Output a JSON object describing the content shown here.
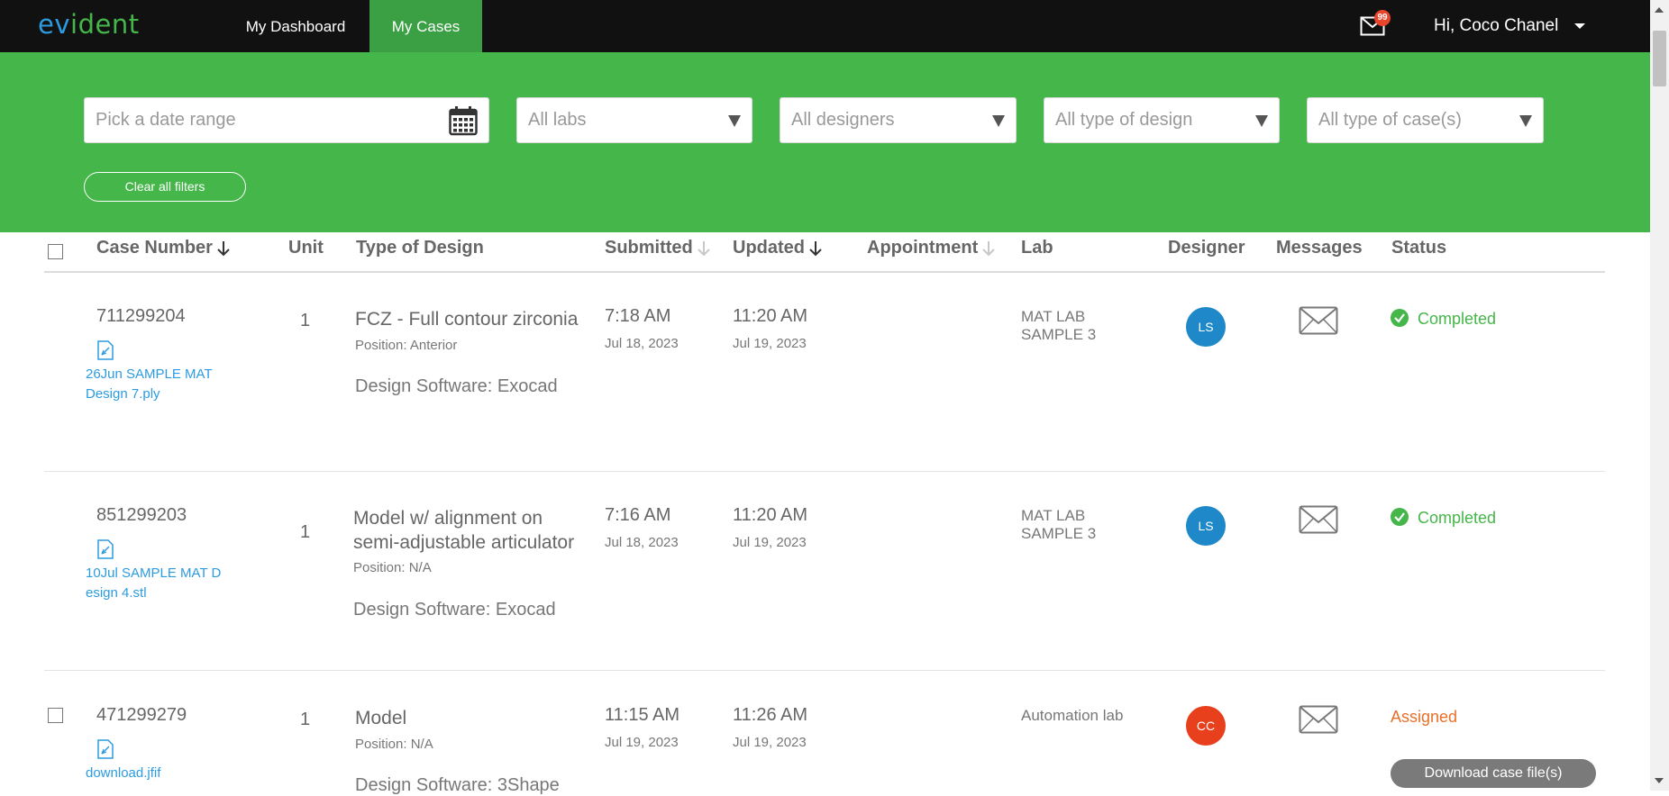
{
  "app": {
    "logo_part1": "ev",
    "logo_part2": "ident",
    "nav": {
      "dashboard": "My Dashboard",
      "cases": "My Cases"
    },
    "mail_badge": "99",
    "user_greeting": "Hi, Coco Chanel"
  },
  "colors": {
    "brand_green": "#45b649",
    "brand_blue": "#2c9be0",
    "topbar": "#111111",
    "assigned_orange": "#e8702a",
    "avatar_blue": "#1e88c8",
    "avatar_red": "#e8401c"
  },
  "filters": {
    "date_placeholder": "Pick a date range",
    "labs": "All labs",
    "designers": "All designers",
    "design_type": "All type of design",
    "case_type": "All type of case(s)",
    "clear_label": "Clear all filters"
  },
  "table": {
    "headers": {
      "case_number": "Case Number",
      "unit": "Unit",
      "type_of_design": "Type of Design",
      "submitted": "Submitted",
      "updated": "Updated",
      "appointment": "Appointment",
      "lab": "Lab",
      "designer": "Designer",
      "messages": "Messages",
      "status": "Status"
    },
    "rows": [
      {
        "case_number": "711299204",
        "file": "26Jun SAMPLE MAT Design 7.ply",
        "unit": "1",
        "design": "FCZ - Full contour zirconia",
        "position": "Position: Anterior",
        "software": "Design Software: Exocad",
        "submitted_time": "7:18 AM",
        "submitted_date": "Jul 18, 2023",
        "updated_time": "11:20 AM",
        "updated_date": "Jul 19, 2023",
        "lab": "MAT LAB SAMPLE 3",
        "designer_initials": "LS",
        "status": "Completed"
      },
      {
        "case_number": "851299203",
        "file": "10Jul SAMPLE MAT Design 4.stl",
        "unit": "1",
        "design": "Model w/ alignment on semi-adjustable articulator",
        "position": "Position: N/A",
        "software": "Design Software: Exocad",
        "submitted_time": "7:16 AM",
        "submitted_date": "Jul 18, 2023",
        "updated_time": "11:20 AM",
        "updated_date": "Jul 19, 2023",
        "lab": "MAT LAB SAMPLE 3",
        "designer_initials": "LS",
        "status": "Completed"
      },
      {
        "case_number": "471299279",
        "file": "download.jfif",
        "unit": "1",
        "design": "Model",
        "position": "Position: N/A",
        "software": "Design Software: 3Shape",
        "submitted_time": "11:15 AM",
        "submitted_date": "Jul 19, 2023",
        "updated_time": "11:26 AM",
        "updated_date": "Jul 19, 2023",
        "lab": "Automation lab",
        "designer_initials": "CC",
        "status": "Assigned",
        "download_label": "Download case file(s)"
      }
    ]
  }
}
